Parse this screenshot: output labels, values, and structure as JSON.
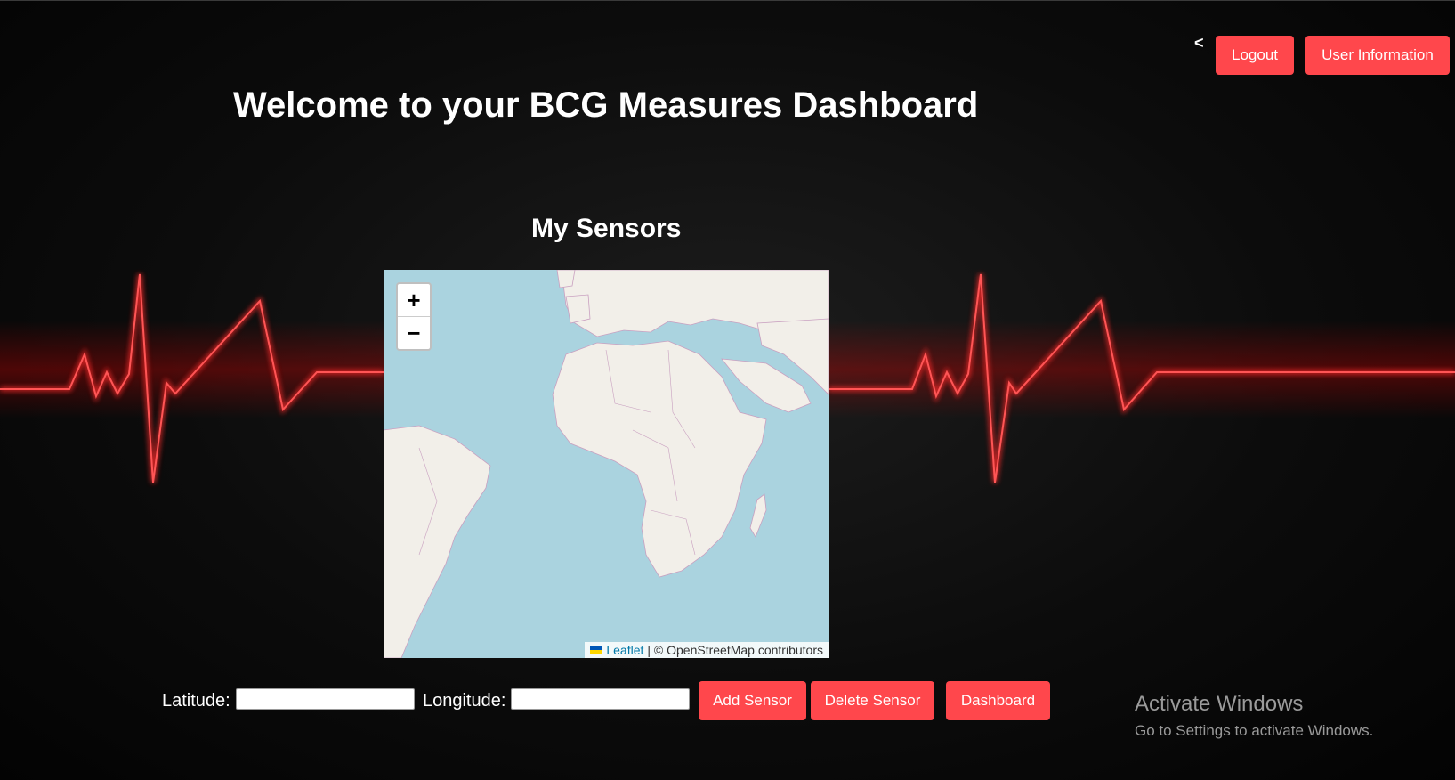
{
  "header": {
    "back_label": "<",
    "logout_label": "Logout",
    "user_info_label": "User Information"
  },
  "page": {
    "title": "Welcome to your BCG Measures Dashboard",
    "subtitle": "My Sensors"
  },
  "map": {
    "zoom_in": "+",
    "zoom_out": "−",
    "attribution_link": "Leaflet",
    "attribution_text": "| © OpenStreetMap contributors"
  },
  "form": {
    "latitude_label": "Latitude:",
    "latitude_value": "",
    "longitude_label": "Longitude:",
    "longitude_value": "",
    "add_label": "Add Sensor",
    "delete_label": "Delete Sensor",
    "dashboard_label": "Dashboard"
  },
  "os_watermark": {
    "title": "Activate Windows",
    "subtitle": "Go to Settings to activate Windows."
  },
  "colors": {
    "accent": "#ff474c",
    "ecg_line": "#ff2a2a",
    "sea": "#aad3df",
    "land": "#f2efe9"
  }
}
